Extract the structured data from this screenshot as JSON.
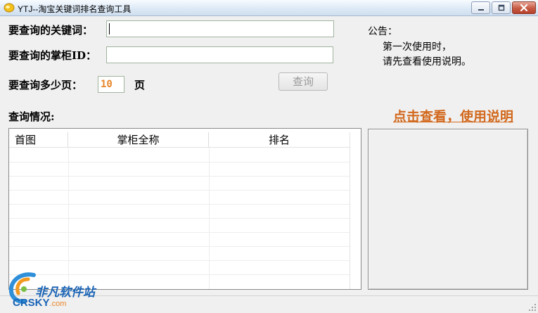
{
  "window": {
    "title": "YTJ--淘宝关键词排名查询工具"
  },
  "form": {
    "keyword_label": "要查询的关键词：",
    "keyword_value": "",
    "shopkeeper_label": "要查询的掌柜ID：",
    "shopkeeper_value": "",
    "pages_label": "要查询多少页：",
    "pages_value": "10",
    "pages_unit": "页",
    "query_button": "查询"
  },
  "notice": {
    "title": "公告：",
    "line1": "第一次使用时，",
    "line2": "请先查看使用说明。"
  },
  "results": {
    "status_label": "查询情况:",
    "help_link": "点击查看，使用说明",
    "columns": [
      "首图",
      "掌柜全称",
      "排名"
    ]
  },
  "watermark": {
    "cn": "非凡软件站",
    "en": "CRSKY",
    "domain": ".com"
  },
  "colors": {
    "accent_orange": "#d2691e",
    "watermark_blue": "#1a64b6"
  }
}
